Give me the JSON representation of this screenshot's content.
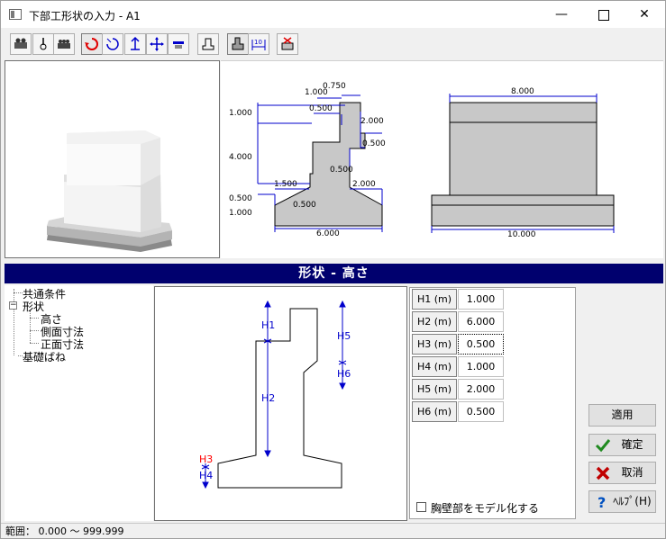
{
  "window": {
    "title": "下部工形状の入力 - A1",
    "min_glyph": "—",
    "close_glyph": "✕"
  },
  "toolbar": {
    "buttons": [
      {
        "name": "view-3d-icon"
      },
      {
        "name": "perspective-icon"
      },
      {
        "name": "render-icon"
      },
      {
        "name": "rotate-icon"
      },
      {
        "name": "rotate-free-icon"
      },
      {
        "name": "pan-up-icon"
      },
      {
        "name": "move-icon"
      },
      {
        "name": "reset-view-icon"
      },
      {
        "name": "front-view-icon"
      },
      {
        "name": "section-view-icon"
      },
      {
        "name": "dimension-icon"
      },
      {
        "name": "clear-icon"
      }
    ]
  },
  "drawing": {
    "side": {
      "top_width": "0.750",
      "top_left": "1.000",
      "notch_w": "0.500",
      "h1": "1.000",
      "h5": "2.000",
      "h6": "0.500",
      "h2": "4.000",
      "slope_w": "0.500",
      "toe_left": "1.500",
      "toe_right": "2.000",
      "h3": "0.500",
      "inner": "0.500",
      "h4": "1.000",
      "base": "6.000"
    },
    "front": {
      "top": "8.000",
      "base": "10.000"
    }
  },
  "header": {
    "title": "形状 - 高さ"
  },
  "tree": {
    "items": [
      {
        "label": "共通条件"
      },
      {
        "label": "形状"
      },
      {
        "label": "高さ"
      },
      {
        "label": "側面寸法"
      },
      {
        "label": "正面寸法"
      },
      {
        "label": "基礎ばね"
      }
    ],
    "collapse_glyph": "−"
  },
  "diagram": {
    "labels": {
      "h1": "H1",
      "h2": "H2",
      "h3": "H3",
      "h4": "H4",
      "h5": "H5",
      "h6": "H6"
    },
    "h3_color": "#ff0000",
    "dim_color": "#0000cc"
  },
  "table": {
    "rows": [
      {
        "label": "H1 (m)",
        "value": "1.000"
      },
      {
        "label": "H2 (m)",
        "value": "6.000"
      },
      {
        "label": "H3 (m)",
        "value": "0.500"
      },
      {
        "label": "H4 (m)",
        "value": "1.000"
      },
      {
        "label": "H5 (m)",
        "value": "2.000"
      },
      {
        "label": "H6 (m)",
        "value": "0.500"
      }
    ]
  },
  "checkbox": {
    "label": "胸壁部をモデル化する",
    "checked": false
  },
  "buttons": {
    "apply": "適用",
    "ok": "確定",
    "cancel": "取消",
    "help": "ﾍﾙﾌﾟ(H)"
  },
  "status": {
    "text": "範囲： 0.000 ～ 999.999"
  },
  "colors": {
    "header_bg": "#00006e",
    "fill_gray": "#c8c8c8",
    "dim_blue": "#0000cc"
  }
}
